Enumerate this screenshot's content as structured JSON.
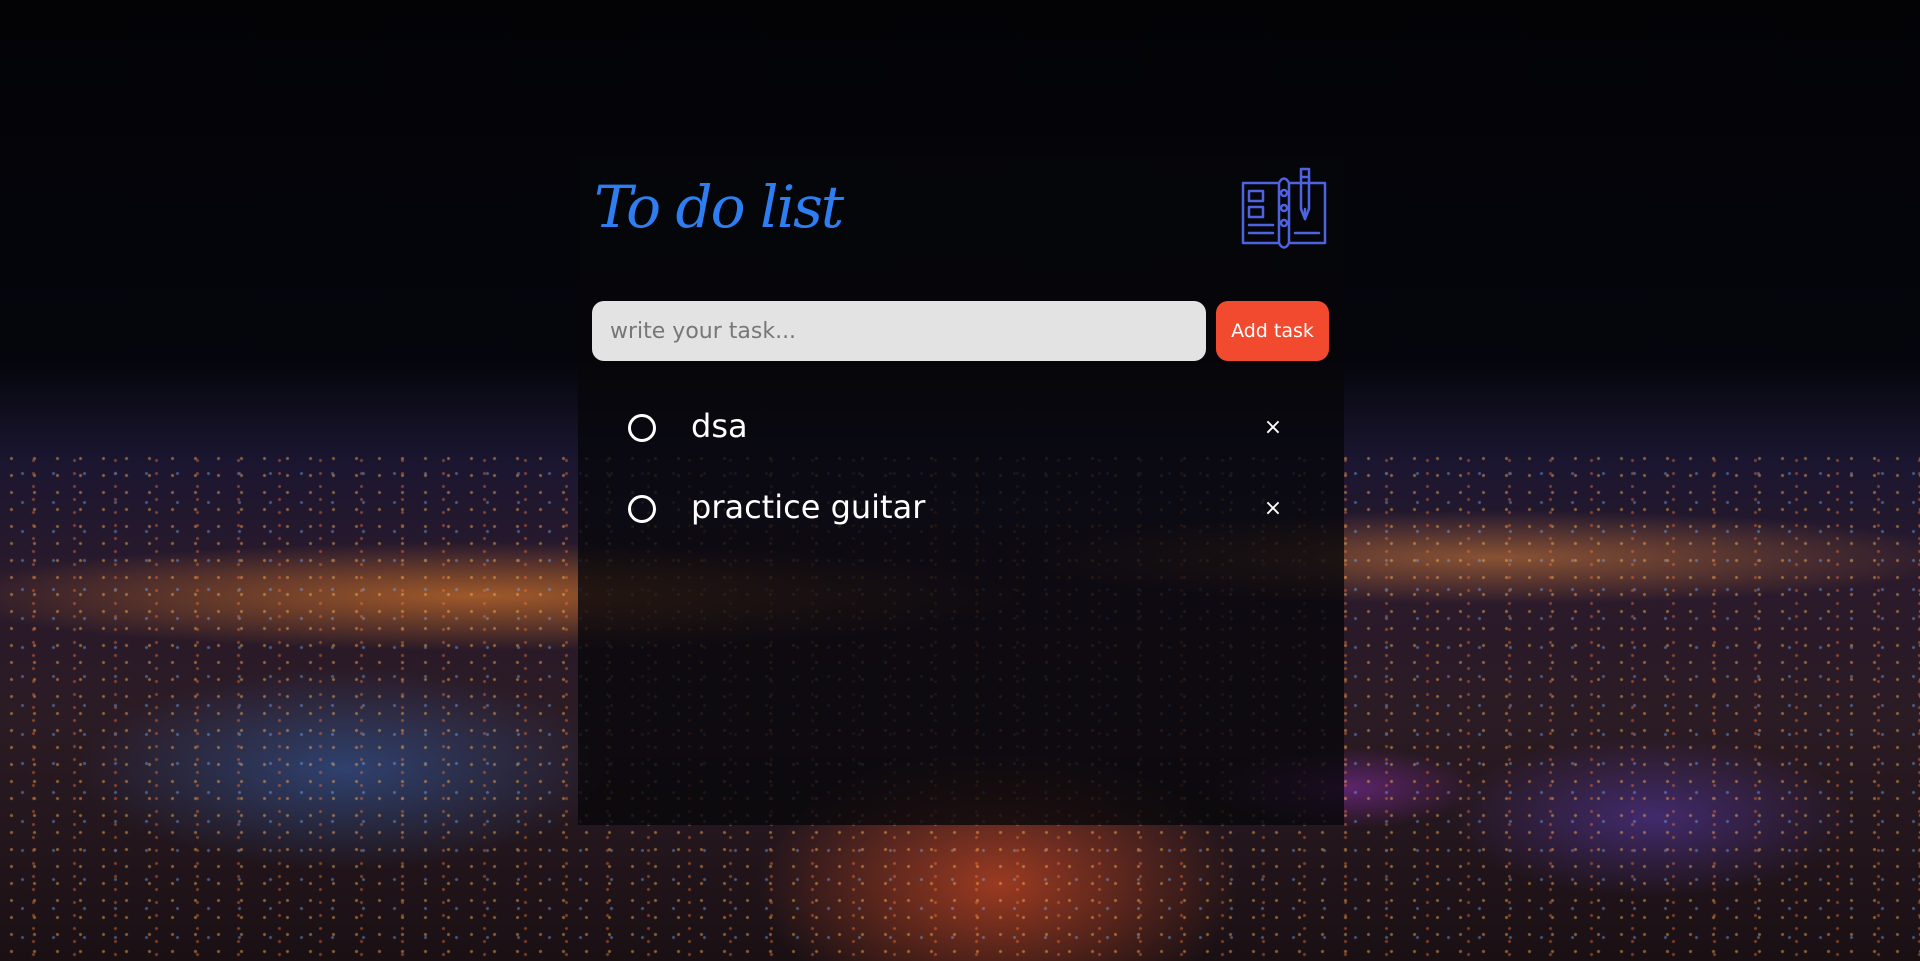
{
  "app": {
    "title": "To do list",
    "icon": "book-pen-icon",
    "accent_color": "#2e7ef2"
  },
  "input": {
    "placeholder": "write your task...",
    "value": ""
  },
  "add_button": {
    "label": "Add task",
    "color": "#f24a2e"
  },
  "tasks": [
    {
      "text": "dsa",
      "checked": false,
      "delete_label": "×"
    },
    {
      "text": "practice guitar",
      "checked": false,
      "delete_label": "×"
    }
  ]
}
